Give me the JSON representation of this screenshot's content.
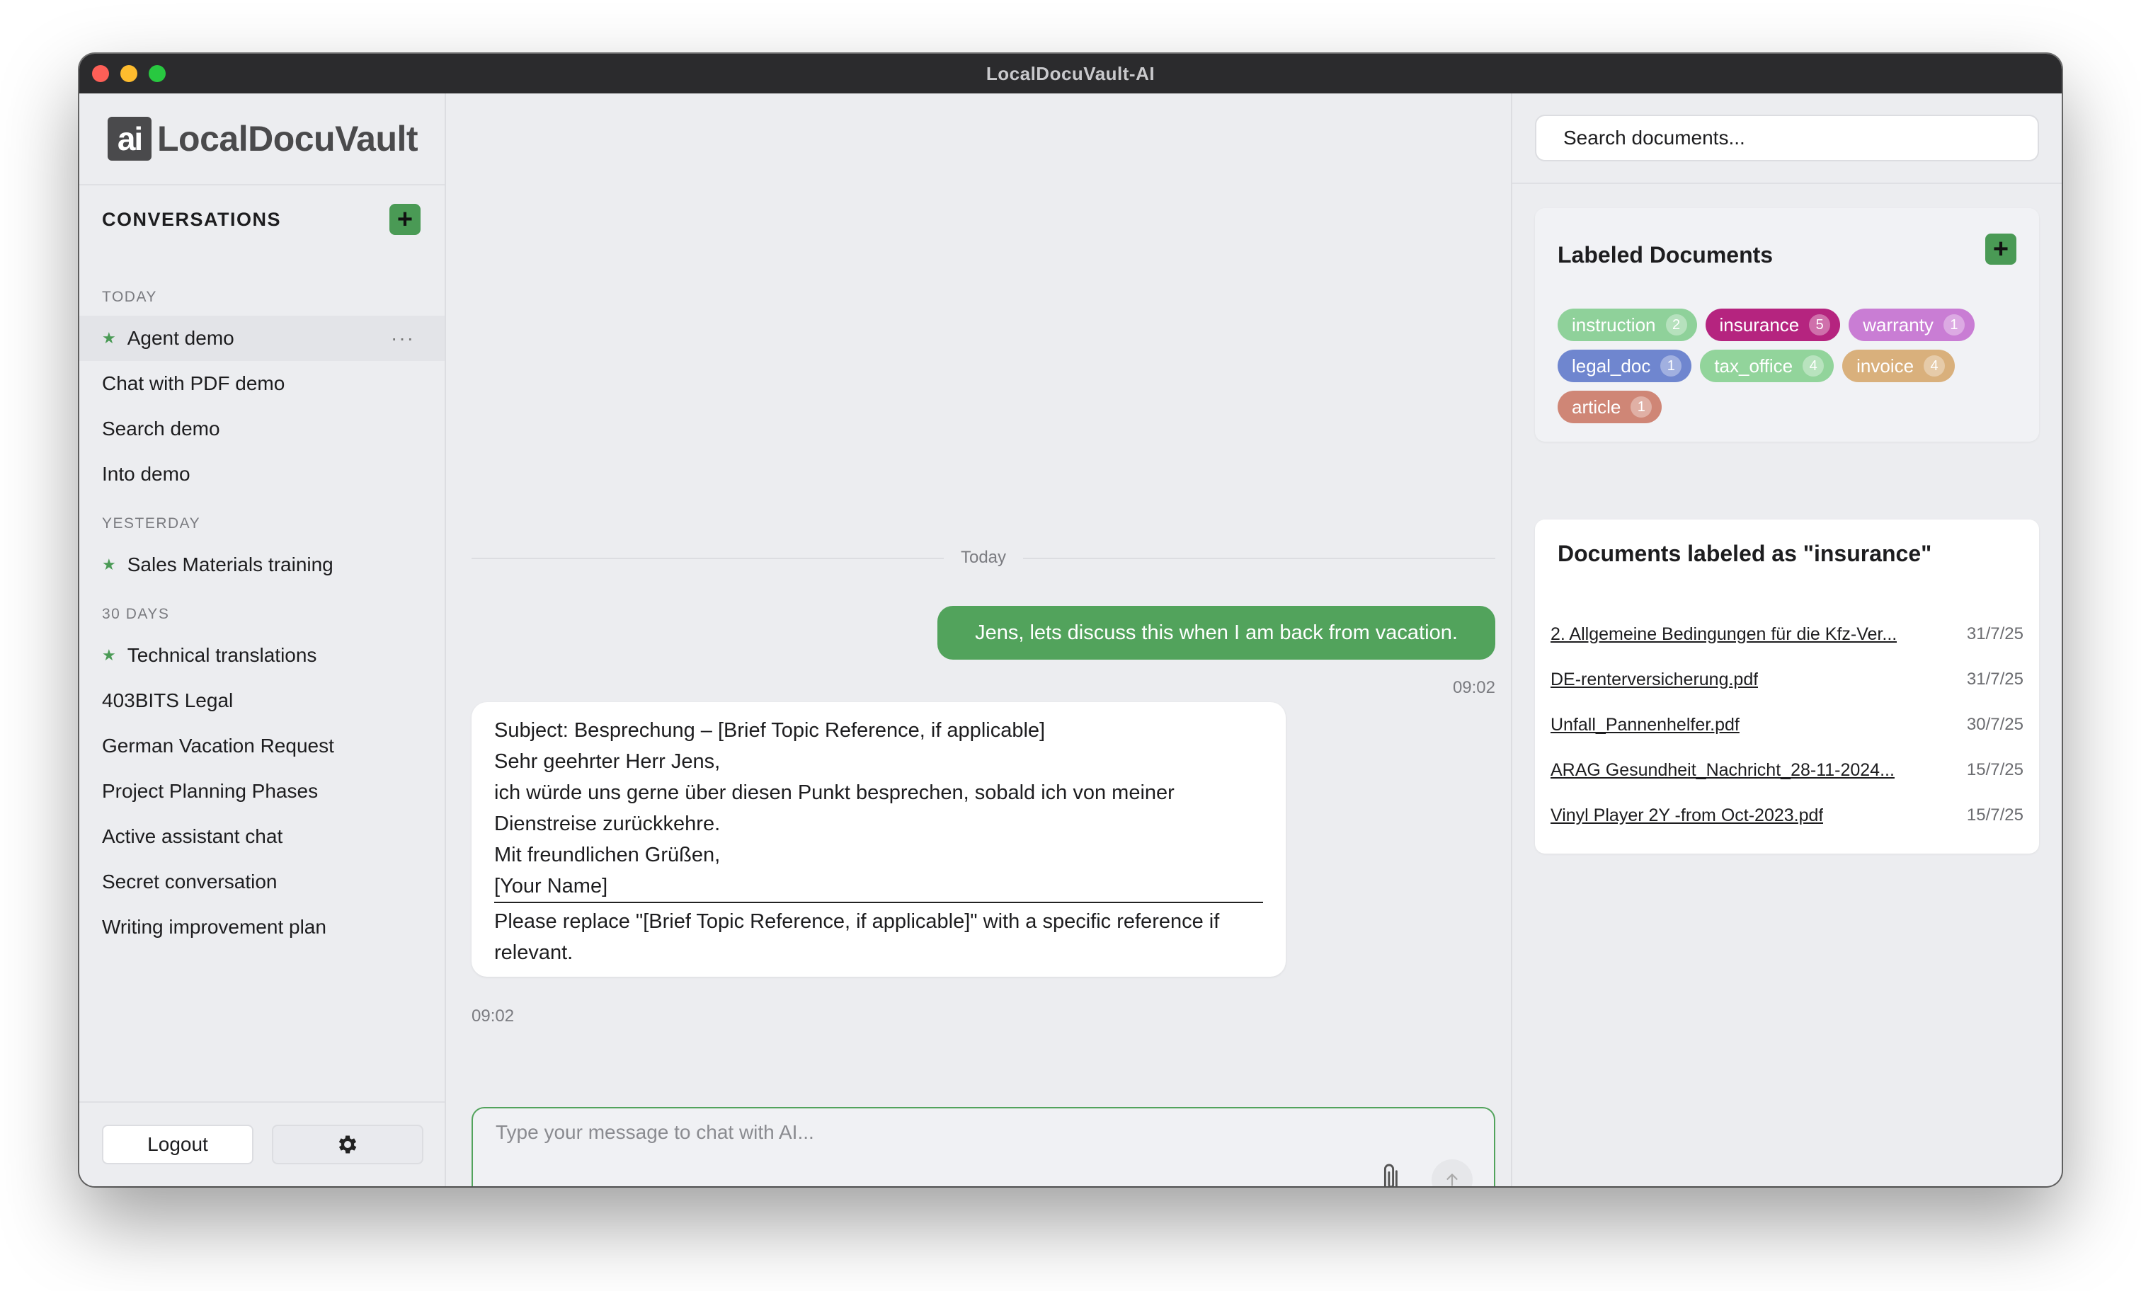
{
  "window": {
    "title": "LocalDocuVault-AI"
  },
  "logo": {
    "mark": "ai",
    "text": "LocalDocuVault"
  },
  "sidebar": {
    "conversations_title": "CONVERSATIONS",
    "sections": [
      {
        "label": "TODAY",
        "items": [
          {
            "label": "Agent demo",
            "starred": true,
            "active": true
          },
          {
            "label": "Chat with PDF demo",
            "starred": false
          },
          {
            "label": "Search demo",
            "starred": false
          },
          {
            "label": "Into demo",
            "starred": false
          }
        ]
      },
      {
        "label": "YESTERDAY",
        "items": [
          {
            "label": "Sales Materials training",
            "starred": true
          }
        ]
      },
      {
        "label": "30 DAYS",
        "items": [
          {
            "label": "Technical translations",
            "starred": true
          },
          {
            "label": "403BITS Legal",
            "starred": false
          },
          {
            "label": "German Vacation Request",
            "starred": false
          },
          {
            "label": "Project Planning Phases",
            "starred": false
          },
          {
            "label": "Active assistant chat",
            "starred": false
          },
          {
            "label": "Secret conversation",
            "starred": false
          },
          {
            "label": "Writing improvement plan",
            "starred": false
          }
        ]
      }
    ],
    "more_icon": "···",
    "logout_label": "Logout",
    "settings_icon": "gear-icon"
  },
  "chat": {
    "day_separator": "Today",
    "user_message": "Jens, lets discuss this when I am back from vacation.",
    "user_time": "09:02",
    "ai_lines": [
      "Subject: Besprechung – [Brief Topic Reference, if applicable]",
      "Sehr geehrter Herr Jens,",
      "ich würde uns gerne über diesen Punkt besprechen, sobald ich von meiner",
      "Dienstreise zurückkehre.",
      "Mit freundlichen Grüßen,"
    ],
    "ai_signature": "[Your Name]",
    "ai_note": "Please replace \"[Brief Topic Reference, if applicable]\" with a specific reference if relevant.",
    "ai_time": "09:02",
    "input_placeholder": "Type your message to chat with AI..."
  },
  "right_panel": {
    "search_placeholder": "Search documents...",
    "labels_title": "Labeled Documents",
    "labels": [
      {
        "name": "instruction",
        "count": "2",
        "color": "#8fd19a"
      },
      {
        "name": "insurance",
        "count": "5",
        "color": "#b5247f"
      },
      {
        "name": "warranty",
        "count": "1",
        "color": "#c97dd4"
      },
      {
        "name": "legal_doc",
        "count": "1",
        "color": "#6f86cf"
      },
      {
        "name": "tax_office",
        "count": "4",
        "color": "#92d49b"
      },
      {
        "name": "invoice",
        "count": "4",
        "color": "#d9b07c"
      },
      {
        "name": "article",
        "count": "1",
        "color": "#cf8676"
      }
    ],
    "docs_title": "Documents labeled as \"insurance\"",
    "documents": [
      {
        "name": "2. Allgemeine Bedingungen für die Kfz-Ver...",
        "date": "31/7/25"
      },
      {
        "name": "DE-renterversicherung.pdf",
        "date": "31/7/25"
      },
      {
        "name": "Unfall_Pannenhelfer.pdf",
        "date": "30/7/25"
      },
      {
        "name": "ARAG Gesundheit_Nachricht_28-11-2024...",
        "date": "15/7/25"
      },
      {
        "name": "Vinyl Player 2Y -from Oct-2023.pdf",
        "date": "15/7/25"
      }
    ]
  }
}
